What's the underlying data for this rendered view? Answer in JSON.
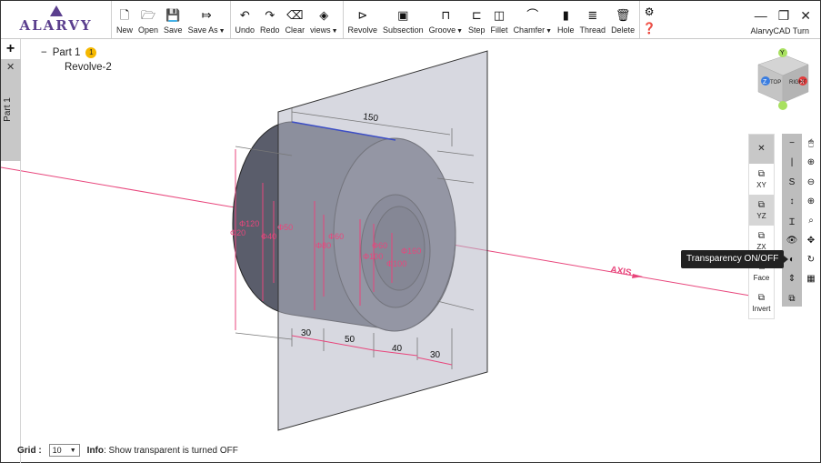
{
  "app": {
    "logo_text": "ALARVY",
    "name": "AlarvyCAD Turn"
  },
  "toolbar": {
    "file": [
      {
        "label": "New",
        "icon": "new-file-icon",
        "glyph": "🗋"
      },
      {
        "label": "Open",
        "icon": "folder-open-icon",
        "glyph": "🗁"
      },
      {
        "label": "Save",
        "icon": "save-icon",
        "glyph": "💾"
      },
      {
        "label": "Save As",
        "icon": "save-as-icon",
        "glyph": "⤇",
        "dropdown": true
      }
    ],
    "edit": [
      {
        "label": "Undo",
        "icon": "undo-icon",
        "glyph": "↶"
      },
      {
        "label": "Redo",
        "icon": "redo-icon",
        "glyph": "↷"
      },
      {
        "label": "Clear",
        "icon": "eraser-icon",
        "glyph": "⌫"
      },
      {
        "label": "views",
        "icon": "cube-icon",
        "glyph": "◈",
        "dropdown": true
      }
    ],
    "features": [
      {
        "label": "Revolve",
        "icon": "revolve-icon",
        "glyph": "⊳"
      },
      {
        "label": "Subsection",
        "icon": "subsection-icon",
        "glyph": "▣"
      },
      {
        "label": "Groove",
        "icon": "groove-icon",
        "glyph": "⊓",
        "dropdown": true
      },
      {
        "label": "Step",
        "icon": "step-icon",
        "glyph": "⊏"
      },
      {
        "label": "Fillet",
        "icon": "fillet-icon",
        "glyph": "◫"
      },
      {
        "label": "Chamfer",
        "icon": "chamfer-icon",
        "glyph": "⌒",
        "dropdown": true
      },
      {
        "label": "Hole",
        "icon": "hole-icon",
        "glyph": "▮"
      },
      {
        "label": "Thread",
        "icon": "thread-icon",
        "glyph": "≣"
      },
      {
        "label": "Delete",
        "icon": "trash-icon",
        "glyph": "🗑"
      }
    ]
  },
  "window_controls": {
    "minimize": "—",
    "restore": "❐",
    "close": "✕"
  },
  "side": {
    "add": "+",
    "close": "✕",
    "tab_label": "Part 1"
  },
  "tree": {
    "part_label": "Part 1",
    "part_badge": "1",
    "child": "Revolve-2",
    "collapse": "−"
  },
  "drawing": {
    "dims": {
      "d150": "150",
      "d30a": "30",
      "d50": "50",
      "d40": "40",
      "d30b": "30"
    },
    "diameters": [
      "Φ120",
      "Φ20",
      "Φ40",
      "Φ50",
      "Φ60",
      "Φ80",
      "Φ100",
      "Φ60",
      "Φ100",
      "Φ160"
    ],
    "axis_label": "AXIS",
    "viewcube": {
      "top": "Y",
      "front": "Z",
      "right": "X",
      "face1": "TOP",
      "face2": "RIGHT"
    }
  },
  "plane_panel": [
    {
      "label": "",
      "glyph": "✕"
    },
    {
      "label": "XY",
      "glyph": "⧉"
    },
    {
      "label": "YZ",
      "glyph": "⧉"
    },
    {
      "label": "ZX",
      "glyph": "⧉"
    },
    {
      "label": "Face",
      "glyph": "⧉"
    },
    {
      "label": "Invert",
      "glyph": "⧉"
    }
  ],
  "tools_col1": [
    "−",
    "|",
    "S",
    "↕",
    "Ɪ",
    "👁",
    "◐",
    "⇕",
    "⧉"
  ],
  "tools_col2": [
    "🖱",
    "⊕",
    "⊖",
    "⊕",
    "⌕",
    "✥",
    "↻",
    "▦"
  ],
  "tooltip": "Transparency ON/OFF",
  "status": {
    "grid_label": "Grid :",
    "grid_value": "10",
    "info_label": "Info",
    "info_text": ": Show transparent is turned OFF"
  }
}
